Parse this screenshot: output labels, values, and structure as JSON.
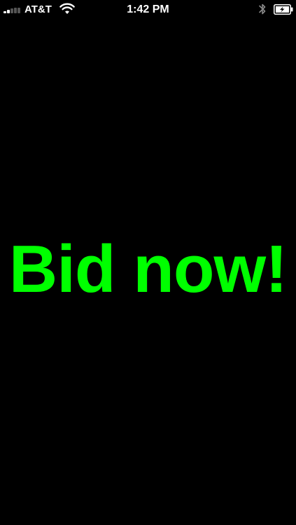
{
  "status_bar": {
    "carrier": "AT&T",
    "time": "1:42 PM",
    "signal_icon": "signal-bars-icon",
    "wifi_icon": "wifi-icon",
    "bluetooth_icon": "bluetooth-icon",
    "battery_icon": "battery-charging-icon"
  },
  "main": {
    "headline": "Bid now!",
    "headline_color": "#00ff00",
    "background_color": "#000000"
  }
}
